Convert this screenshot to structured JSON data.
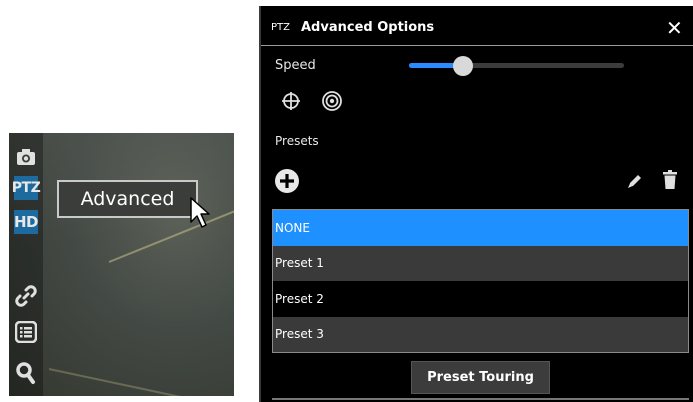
{
  "camera": {
    "toolbar": {
      "ptz_label": "PTZ",
      "hd_label": "HD"
    },
    "tooltip": "Advanced"
  },
  "panel": {
    "header_prefix": "PTZ",
    "title": "Advanced Options",
    "close_glyph": "✕",
    "speed": {
      "label": "Speed",
      "value": 0.25
    },
    "presets_label": "Presets",
    "presets": [
      {
        "label": "NONE",
        "selected": true
      },
      {
        "label": "Preset 1",
        "selected": false
      },
      {
        "label": "Preset 2",
        "selected": false
      },
      {
        "label": "Preset 3",
        "selected": false
      }
    ],
    "touring_button": "Preset Touring"
  },
  "colors": {
    "accent": "#1e90ff",
    "slider_fill": "#2b8cff",
    "toolbar_active": "#1c6a9e"
  },
  "icons": [
    "camera-icon",
    "link-icon",
    "list-icon",
    "search-icon",
    "crosshair-icon",
    "target-icon",
    "add-icon",
    "edit-icon",
    "trash-icon",
    "close-icon",
    "cursor-icon"
  ]
}
